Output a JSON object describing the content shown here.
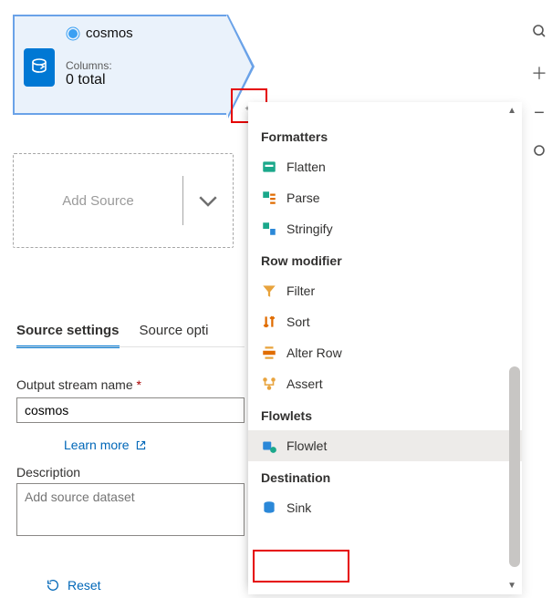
{
  "node": {
    "title": "cosmos",
    "columns_label": "Columns:",
    "columns_value": "0 total"
  },
  "add_source": {
    "label": "Add Source"
  },
  "tabs": {
    "active": "Source settings",
    "other": "Source opti"
  },
  "form": {
    "output_label": "Output stream name",
    "output_value": "cosmos",
    "learn_more": "Learn more",
    "description_label": "Description",
    "description_placeholder": "Add source dataset",
    "reset": "Reset"
  },
  "menu": {
    "groups": [
      {
        "title": "Formatters",
        "items": [
          {
            "name": "flatten",
            "label": "Flatten",
            "icon": "flatten-icon"
          },
          {
            "name": "parse",
            "label": "Parse",
            "icon": "parse-icon"
          },
          {
            "name": "stringify",
            "label": "Stringify",
            "icon": "stringify-icon"
          }
        ]
      },
      {
        "title": "Row modifier",
        "items": [
          {
            "name": "filter",
            "label": "Filter",
            "icon": "filter-icon"
          },
          {
            "name": "sort",
            "label": "Sort",
            "icon": "sort-icon"
          },
          {
            "name": "alterrow",
            "label": "Alter Row",
            "icon": "alterrow-icon"
          },
          {
            "name": "assert",
            "label": "Assert",
            "icon": "assert-icon"
          }
        ]
      },
      {
        "title": "Flowlets",
        "items": [
          {
            "name": "flowlet",
            "label": "Flowlet",
            "icon": "flowlet-icon",
            "hover": true
          }
        ]
      },
      {
        "title": "Destination",
        "items": [
          {
            "name": "sink",
            "label": "Sink",
            "icon": "sink-icon"
          }
        ]
      }
    ]
  },
  "colors": {
    "accent": "#0078d4",
    "highlight": "#e50000"
  }
}
